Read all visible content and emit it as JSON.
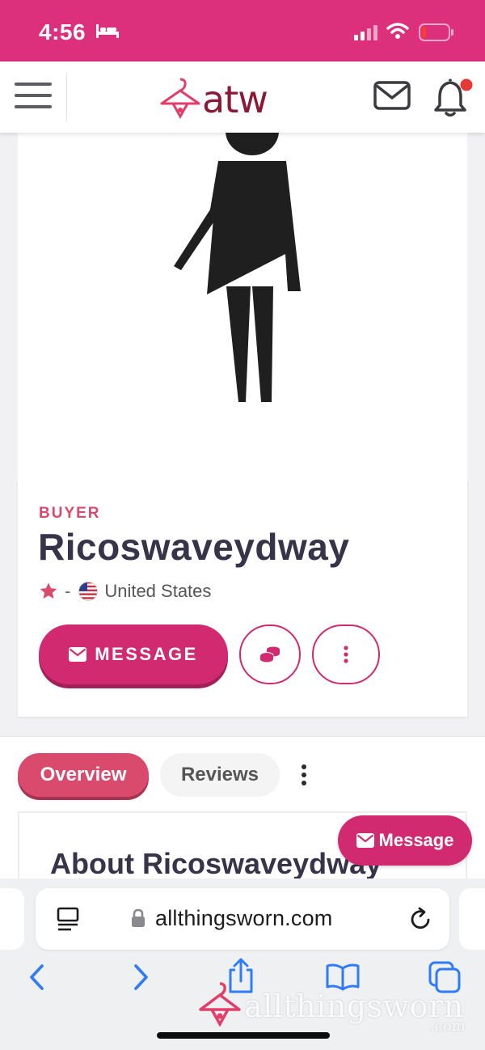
{
  "status_bar": {
    "time": "4:56"
  },
  "header": {
    "logo_text": "atw"
  },
  "profile": {
    "role": "BUYER",
    "username": "Ricoswaveydway",
    "rating": "-",
    "country": "United States",
    "message_label": "MESSAGE"
  },
  "tabs": [
    {
      "label": "Overview",
      "active": true
    },
    {
      "label": "Reviews",
      "active": false
    }
  ],
  "about": {
    "title": "About Ricoswaveydway"
  },
  "floating_button": {
    "label": "Message"
  },
  "browser": {
    "url": "allthingsworn.com"
  },
  "watermark": {
    "text": "allthingsworn",
    "suffix": ".com"
  },
  "colors": {
    "brand_pink": "#dc2f7c",
    "button_pink": "#d12a70",
    "accent_rose": "#d94a6d",
    "logo_maroon": "#8a1a36",
    "ios_blue": "#2f7cf6"
  }
}
